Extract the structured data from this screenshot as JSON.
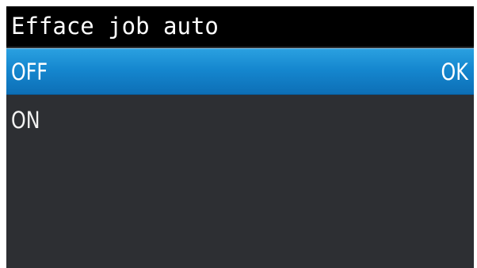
{
  "header": {
    "title": "Efface job auto"
  },
  "menu": {
    "items": [
      {
        "label": "OFF",
        "selected": true,
        "action_label": "OK"
      },
      {
        "label": "ON",
        "selected": false
      }
    ]
  },
  "colors": {
    "title_background": "#000000",
    "screen_background": "#2d2f33",
    "selection_highlight": "#1587cf",
    "text": "#ffffff"
  }
}
